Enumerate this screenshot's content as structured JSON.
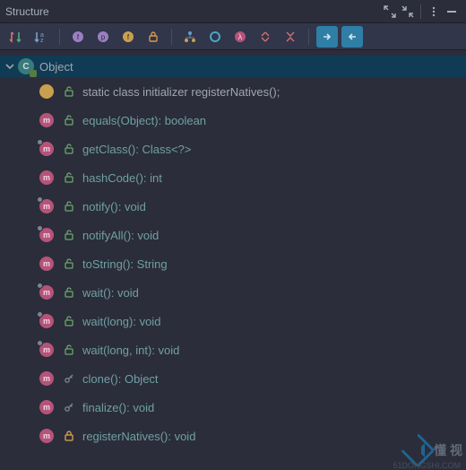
{
  "panel": {
    "title": "Structure"
  },
  "root": {
    "label": "Object"
  },
  "members": [
    {
      "kind": "init",
      "vis": "open",
      "corner": false,
      "text": "static class initializer  registerNatives();"
    },
    {
      "kind": "method",
      "vis": "open",
      "corner": false,
      "text": "equals(Object): boolean"
    },
    {
      "kind": "method",
      "vis": "open",
      "corner": true,
      "text": "getClass(): Class<?>"
    },
    {
      "kind": "method",
      "vis": "open",
      "corner": false,
      "text": "hashCode(): int"
    },
    {
      "kind": "method",
      "vis": "open",
      "corner": true,
      "text": "notify(): void"
    },
    {
      "kind": "method",
      "vis": "open",
      "corner": true,
      "text": "notifyAll(): void"
    },
    {
      "kind": "method",
      "vis": "open",
      "corner": false,
      "text": "toString(): String"
    },
    {
      "kind": "method",
      "vis": "open",
      "corner": true,
      "text": "wait(): void"
    },
    {
      "kind": "method",
      "vis": "open",
      "corner": true,
      "text": "wait(long): void"
    },
    {
      "kind": "method",
      "vis": "open",
      "corner": true,
      "text": "wait(long, int): void"
    },
    {
      "kind": "method",
      "vis": "key",
      "corner": false,
      "text": "clone(): Object"
    },
    {
      "kind": "method",
      "vis": "key",
      "corner": false,
      "text": "finalize(): void"
    },
    {
      "kind": "method",
      "vis": "closed",
      "corner": false,
      "text": "registerNatives(): void"
    }
  ],
  "watermark": {
    "text": "懂 视",
    "sub": "51DONGSHI.COM"
  }
}
